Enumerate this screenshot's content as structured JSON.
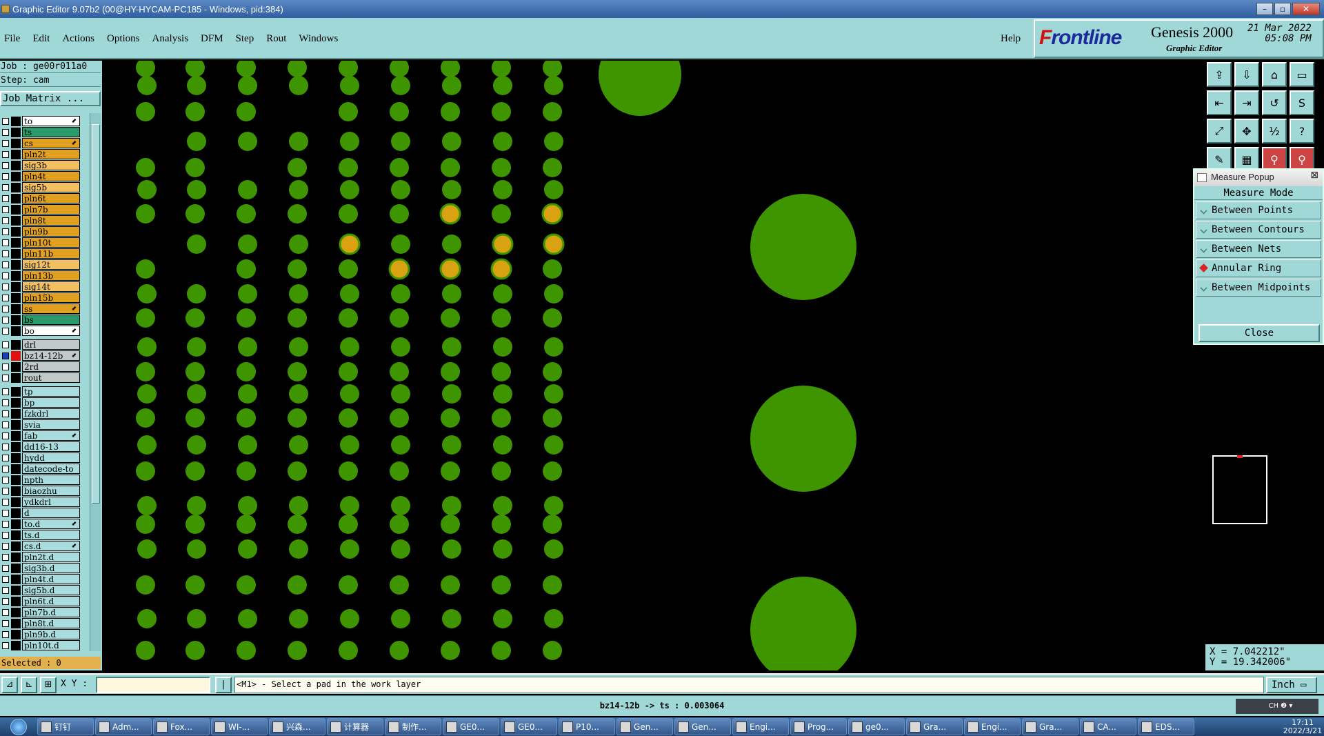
{
  "window": {
    "title": "Graphic Editor 9.07b2 (00@HY-HYCAM-PC185 - Windows, pid:384)"
  },
  "menu": {
    "items": [
      "File",
      "Edit",
      "Actions",
      "Options",
      "Analysis",
      "DFM",
      "Step",
      "Rout",
      "Windows"
    ],
    "help": "Help"
  },
  "brand": {
    "logo_f": "F",
    "logo_rest": "rontline",
    "product": "Genesis 2000",
    "subtitle": "Graphic Editor",
    "date": "21 Mar 2022",
    "time": "05:08 PM"
  },
  "job": {
    "job_line": "Job : ge00r011a0",
    "step_line": "Step: cam",
    "matrix_button": "Job Matrix ..."
  },
  "layers": {
    "group1": [
      {
        "name": "to",
        "color": "#ffffff",
        "swatch": "#000000",
        "arrow": true
      },
      {
        "name": "ts",
        "color": "#2a9a6a",
        "swatch": "#000000",
        "arrow": false
      },
      {
        "name": "cs",
        "color": "#e2a020",
        "swatch": "#000000",
        "arrow": true
      },
      {
        "name": "pln2t",
        "color": "#e2a020",
        "swatch": "#000000",
        "arrow": false
      },
      {
        "name": "sig3b",
        "color": "#f2c060",
        "swatch": "#000000",
        "arrow": false
      },
      {
        "name": "pln4t",
        "color": "#e2a020",
        "swatch": "#000000",
        "arrow": false
      },
      {
        "name": "sig5b",
        "color": "#f2c060",
        "swatch": "#000000",
        "arrow": false
      },
      {
        "name": "pln6t",
        "color": "#e2a020",
        "swatch": "#000000",
        "arrow": false
      },
      {
        "name": "pln7b",
        "color": "#e2a020",
        "swatch": "#000000",
        "arrow": false
      },
      {
        "name": "pln8t",
        "color": "#e2a020",
        "swatch": "#000000",
        "arrow": false
      },
      {
        "name": "pln9b",
        "color": "#e2a020",
        "swatch": "#000000",
        "arrow": false
      },
      {
        "name": "pln10t",
        "color": "#e2a020",
        "swatch": "#000000",
        "arrow": false
      },
      {
        "name": "pln11b",
        "color": "#e2a020",
        "swatch": "#000000",
        "arrow": false
      },
      {
        "name": "sig12t",
        "color": "#f2c060",
        "swatch": "#000000",
        "arrow": false
      },
      {
        "name": "pln13b",
        "color": "#e2a020",
        "swatch": "#000000",
        "arrow": false
      },
      {
        "name": "sig14t",
        "color": "#f2c060",
        "swatch": "#000000",
        "arrow": false
      },
      {
        "name": "pln15b",
        "color": "#e2a020",
        "swatch": "#000000",
        "arrow": false
      },
      {
        "name": "ss",
        "color": "#e2a020",
        "swatch": "#000000",
        "arrow": true
      },
      {
        "name": "bs",
        "color": "#2a9a6a",
        "swatch": "#000000",
        "arrow": false
      },
      {
        "name": "bo",
        "color": "#ffffff",
        "swatch": "#000000",
        "arrow": true
      }
    ],
    "group2": [
      {
        "name": "drl",
        "color": "#c0c8c8",
        "swatch": "#000000",
        "arrow": false,
        "checked": false
      },
      {
        "name": "bz14-12b",
        "color": "#c0c8c8",
        "swatch": "#e01010",
        "arrow": true,
        "checked": true
      },
      {
        "name": "2rd",
        "color": "#c0c8c8",
        "swatch": "#000000",
        "arrow": false,
        "checked": false
      },
      {
        "name": "rout",
        "color": "#c0c8c8",
        "swatch": "#000000",
        "arrow": false,
        "checked": false
      }
    ],
    "group3": [
      {
        "name": "tp",
        "arrow": false
      },
      {
        "name": "bp",
        "arrow": false
      },
      {
        "name": "fzkdrl",
        "arrow": false
      },
      {
        "name": "svia",
        "arrow": false
      },
      {
        "name": "fab",
        "arrow": true
      },
      {
        "name": "dd16-13",
        "arrow": false
      },
      {
        "name": "hydd",
        "arrow": false
      },
      {
        "name": "datecode-to",
        "arrow": false
      },
      {
        "name": "npth",
        "arrow": false
      },
      {
        "name": "biaozhu",
        "arrow": false
      },
      {
        "name": "ydkdrl",
        "arrow": false
      },
      {
        "name": "d",
        "arrow": false
      },
      {
        "name": "to.d",
        "arrow": true
      },
      {
        "name": "ts.d",
        "arrow": false
      },
      {
        "name": "cs.d",
        "arrow": true
      },
      {
        "name": "pln2t.d",
        "arrow": false
      },
      {
        "name": "sig3b.d",
        "arrow": false
      },
      {
        "name": "pln4t.d",
        "arrow": false
      },
      {
        "name": "sig5b.d",
        "arrow": false
      },
      {
        "name": "pln6t.d",
        "arrow": false
      },
      {
        "name": "pln7b.d",
        "arrow": false
      },
      {
        "name": "pln8t.d",
        "arrow": false
      },
      {
        "name": "pln9b.d",
        "arrow": false
      },
      {
        "name": "pln10t.d",
        "arrow": false
      }
    ],
    "group3_color": "#a9dcdc"
  },
  "selected": "Selected : 0",
  "measure_popup": {
    "title": "Measure Popup",
    "mode_label": "Measure Mode",
    "options": [
      "Between Points",
      "Between Contours",
      "Between Nets",
      "Annular Ring",
      "Between Midpoints"
    ],
    "selected_option": "Annular Ring",
    "close": "Close"
  },
  "toolbar": {
    "icons": [
      "export-icon",
      "import-icon",
      "home-icon",
      "window-icon",
      "snap-left-icon",
      "snap-right-icon",
      "rotate-icon",
      "s-curve-icon",
      "fit-icon",
      "zoom-fit-icon",
      "scale-1to2-icon",
      "help-icon",
      "pen-icon",
      "grid-icon",
      "net-left-icon",
      "net-right-icon"
    ]
  },
  "coords": {
    "x": "X = 7.042212\"",
    "y": "Y = 19.342006\""
  },
  "command": {
    "xy_label": "X Y :",
    "input_value": "",
    "prompt": "<M1> - Select a pad in the work layer",
    "unit": "Inch"
  },
  "status": "bz14-12b -> ts : 0.003064",
  "ime": "CH",
  "taskbar": {
    "items": [
      "钉钉",
      "Adm...",
      "Fox...",
      "WI-...",
      "兴森...",
      "计算器",
      "制作...",
      "GE0...",
      "GE0...",
      "P10...",
      "Gen...",
      "Gen...",
      "Engi...",
      "Prog...",
      "ge0...",
      "Gra...",
      "Engi...",
      "Gra...",
      "CA...",
      "EDS..."
    ],
    "time": "17:11",
    "date": "2022/3/21"
  },
  "colors": {
    "pad_green": "#3f9500",
    "pad_orange": "#d9a213",
    "panel": "#a0d8d8"
  }
}
